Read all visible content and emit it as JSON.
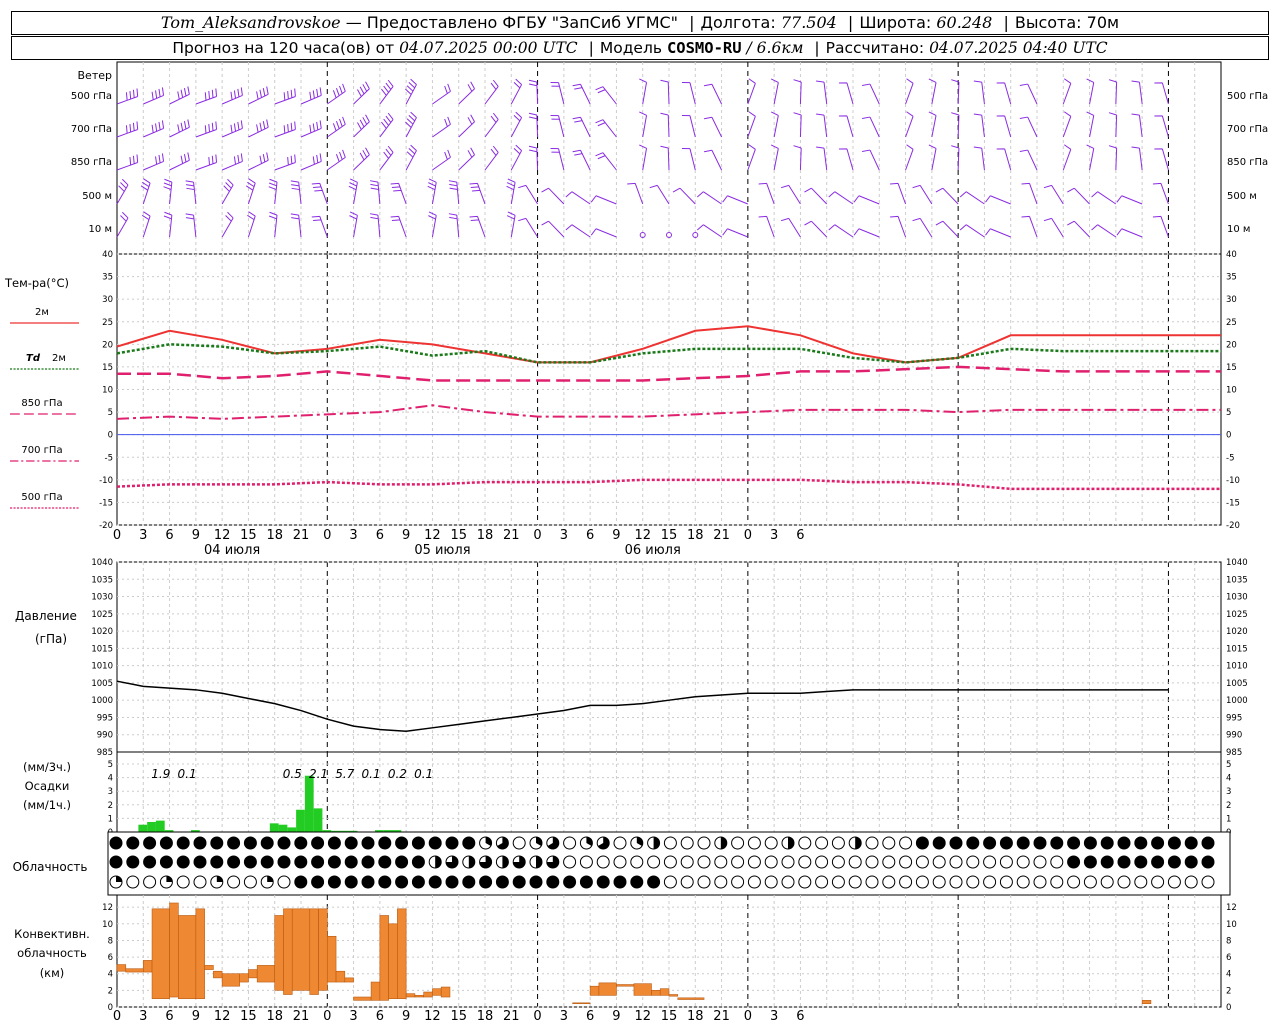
{
  "header": {
    "station": "Tom_Aleksandrovskoe",
    "provider": "— Предоставлено ФГБУ \"ЗапСиб УГМС\"",
    "lon_label": "Долгота:",
    "lon_value": "77.504",
    "lat_label": "Широта:",
    "lat_value": "60.248",
    "alt_label": "Высота:",
    "alt_value": "70м",
    "forecast_prefix": "Прогноз на 120 часа(ов) от",
    "forecast_start": "04.07.2025 00:00 UTC",
    "model_label": "Модель",
    "model_name": "COSMO-RU",
    "model_res": "/ 6.6км",
    "computed_label": "Рассчитано:",
    "computed_value": "04.07.2025 04:40 UTC"
  },
  "colors": {
    "wind": "#8a2be2",
    "t2m": "#ee3333",
    "td2m": "#1a7a1a",
    "t850": "#e0206e",
    "t700": "#e0206e",
    "t500": "#e0206e",
    "zero_line": "#4455ee",
    "precip": "#22cc22",
    "convective": "#ef8833",
    "grid": "#cccccc"
  },
  "x_axis": {
    "hour_ticks": [
      "0",
      "3",
      "6",
      "9",
      "12",
      "15",
      "18",
      "21",
      "0",
      "3",
      "6",
      "9",
      "12",
      "15",
      "18",
      "21",
      "0",
      "3",
      "6",
      "9",
      "12",
      "15",
      "18",
      "21",
      "0",
      "3",
      "6"
    ],
    "days": [
      "04 июля",
      "05 июля",
      "06 июля"
    ]
  },
  "wind_panel": {
    "title": "Ветер",
    "levels": [
      "500 гПа",
      "700 гПа",
      "850 гПа",
      "500 м",
      "10 м"
    ]
  },
  "temp_panel": {
    "legend": {
      "t2m": "2м",
      "td_sym": "Td",
      "td_lev": "2м",
      "t850": "850 гПа",
      "t700": "700 гПа",
      "t500": "500 гПа"
    }
  },
  "pressure_panel": {
    "title": "Давление",
    "unit": "(гПа)"
  },
  "precip_panel": {
    "unit3h": "(мм/3ч.)",
    "title": "Осадки",
    "unit1h": "(мм/1ч.)"
  },
  "cloud_panel": {
    "title": "Облачность"
  },
  "conv_panel": {
    "title": "Конвективн.",
    "title2": "облачность",
    "unit": "(км)"
  },
  "chart_data": [
    {
      "type": "line",
      "title": "Тем-ра(°С)",
      "x_hours": [
        0,
        6,
        12,
        18,
        24,
        30,
        36,
        42,
        48,
        54,
        60,
        66,
        72,
        78,
        84,
        90,
        96,
        102,
        108,
        114,
        120,
        126
      ],
      "ylim": [
        -20,
        40
      ],
      "yticks": [
        -20,
        -15,
        -10,
        -5,
        0,
        5,
        10,
        15,
        20,
        25,
        30,
        35,
        40
      ],
      "series": [
        {
          "name": "2м",
          "key": "t2m",
          "values": [
            19.5,
            23,
            21,
            18,
            19,
            21,
            20,
            18,
            16,
            16,
            19,
            23,
            24,
            22,
            18,
            16,
            17,
            22,
            22,
            22,
            22,
            22
          ]
        },
        {
          "name": "Td 2м",
          "key": "td2m",
          "values": [
            18,
            20,
            19.5,
            18,
            18.5,
            19.5,
            17.5,
            18.5,
            16,
            16,
            18,
            19,
            19,
            19,
            17,
            16,
            17,
            19,
            18.5,
            18.5,
            18.5,
            18.5
          ]
        },
        {
          "name": "850 гПа",
          "key": "t850",
          "values": [
            13.5,
            13.5,
            12.5,
            13,
            14,
            13,
            12,
            12,
            12,
            12,
            12,
            12.5,
            13,
            14,
            14,
            14.5,
            15,
            14.5,
            14,
            14,
            14,
            14
          ]
        },
        {
          "name": "700 гПа",
          "key": "t700",
          "values": [
            3.5,
            4,
            3.5,
            4,
            4.5,
            5,
            6.5,
            5,
            4,
            4,
            4,
            4.5,
            5,
            5.5,
            5.5,
            5.5,
            5,
            5.5,
            5.5,
            5.5,
            5.5,
            5.5
          ]
        },
        {
          "name": "500 гПа",
          "key": "t500",
          "values": [
            -11.5,
            -11,
            -11,
            -11,
            -10.5,
            -11,
            -11,
            -10.5,
            -10.5,
            -10.5,
            -10,
            -10,
            -10,
            -10,
            -10.5,
            -10.5,
            -11,
            -12,
            -12,
            -12,
            -12,
            -12
          ]
        }
      ]
    },
    {
      "type": "line",
      "title": "Давление",
      "x_hours": [
        0,
        3,
        6,
        9,
        12,
        15,
        18,
        21,
        24,
        27,
        30,
        33,
        36,
        39,
        42,
        45,
        48,
        51,
        54,
        57,
        60,
        63,
        66,
        69,
        72,
        75,
        78,
        81,
        84,
        87,
        90,
        93,
        96,
        99,
        102,
        105,
        108,
        111,
        114,
        117,
        120
      ],
      "values": [
        1005.5,
        1004,
        1003.5,
        1003,
        1002,
        1000.5,
        999,
        997,
        994.5,
        992.5,
        991.5,
        991,
        992,
        993,
        994,
        995,
        996,
        997,
        998.5,
        998.5,
        999,
        1000,
        1001,
        1001.5,
        1002,
        1002,
        1002,
        1002.5,
        1003,
        1003,
        1003,
        1003,
        1003,
        1003,
        1003,
        1003,
        1003,
        1003,
        1003,
        1003,
        1003
      ],
      "ylim": [
        985,
        1040
      ],
      "yticks": [
        985,
        990,
        995,
        1000,
        1005,
        1010,
        1015,
        1020,
        1025,
        1030,
        1035,
        1040
      ]
    },
    {
      "type": "bar",
      "title": "Осадки",
      "x_hours": [
        3,
        4,
        5,
        6,
        9,
        18,
        19,
        20,
        21,
        22,
        23,
        24,
        25,
        26,
        27,
        30,
        31,
        32
      ],
      "values": [
        0.5,
        0.7,
        0.8,
        0.1,
        0.1,
        0.6,
        0.5,
        0.3,
        1.6,
        4.1,
        1.7,
        0.1,
        0.05,
        0.05,
        0.05,
        0.1,
        0.1,
        0.1
      ],
      "ylim": [
        0,
        5
      ],
      "yticks": [
        0,
        1,
        2,
        3,
        4,
        5
      ],
      "totals_3h": [
        {
          "hour": 5,
          "label": "1.9"
        },
        {
          "hour": 8,
          "label": "0.1"
        },
        {
          "hour": 20,
          "label": "0.5"
        },
        {
          "hour": 23,
          "label": "2.1"
        },
        {
          "hour": 26,
          "label": "5.7"
        },
        {
          "hour": 29,
          "label": "0.1"
        },
        {
          "hour": 32,
          "label": "0.2"
        },
        {
          "hour": 35,
          "label": "0.1"
        }
      ]
    },
    {
      "type": "bar",
      "title": "Конвективн. облачность",
      "yticks": [
        0,
        2,
        4,
        6,
        8,
        10,
        12
      ],
      "ylim": [
        0,
        13
      ],
      "bars": [
        {
          "h0": 0,
          "h1": 1,
          "base": 4.3,
          "top": 5.1
        },
        {
          "h0": 1,
          "h1": 3,
          "base": 4.2,
          "top": 4.6
        },
        {
          "h0": 3,
          "h1": 4,
          "base": 4.2,
          "top": 5.6
        },
        {
          "h0": 4,
          "h1": 6,
          "base": 1.0,
          "top": 11.8
        },
        {
          "h0": 6,
          "h1": 7,
          "base": 1.2,
          "top": 12.5
        },
        {
          "h0": 7,
          "h1": 9,
          "base": 1.0,
          "top": 11.0
        },
        {
          "h0": 9,
          "h1": 10,
          "base": 1.0,
          "top": 11.8
        },
        {
          "h0": 10,
          "h1": 11,
          "base": 4.5,
          "top": 5.0
        },
        {
          "h0": 11,
          "h1": 12,
          "base": 3.5,
          "top": 4.3
        },
        {
          "h0": 12,
          "h1": 14,
          "base": 2.5,
          "top": 4.0
        },
        {
          "h0": 14,
          "h1": 15,
          "base": 3.0,
          "top": 4.0
        },
        {
          "h0": 15,
          "h1": 16,
          "base": 3.5,
          "top": 4.5
        },
        {
          "h0": 16,
          "h1": 18,
          "base": 3.0,
          "top": 5.0
        },
        {
          "h0": 18,
          "h1": 19,
          "base": 2.0,
          "top": 11.0
        },
        {
          "h0": 19,
          "h1": 20,
          "base": 1.5,
          "top": 11.8
        },
        {
          "h0": 20,
          "h1": 22,
          "base": 2.0,
          "top": 11.8
        },
        {
          "h0": 22,
          "h1": 23,
          "base": 1.5,
          "top": 11.8
        },
        {
          "h0": 23,
          "h1": 24,
          "base": 2.0,
          "top": 11.8
        },
        {
          "h0": 24,
          "h1": 25,
          "base": 3.0,
          "top": 8.5
        },
        {
          "h0": 25,
          "h1": 26,
          "base": 3.0,
          "top": 4.3
        },
        {
          "h0": 26,
          "h1": 27,
          "base": 3.0,
          "top": 3.5
        },
        {
          "h0": 27,
          "h1": 29,
          "base": 0.8,
          "top": 1.2
        },
        {
          "h0": 29,
          "h1": 30,
          "base": 0.8,
          "top": 3.0
        },
        {
          "h0": 30,
          "h1": 31,
          "base": 0.8,
          "top": 11.0
        },
        {
          "h0": 31,
          "h1": 32,
          "base": 1.0,
          "top": 10.0
        },
        {
          "h0": 32,
          "h1": 33,
          "base": 1.0,
          "top": 11.8
        },
        {
          "h0": 33,
          "h1": 34,
          "base": 1.2,
          "top": 1.6
        },
        {
          "h0": 34,
          "h1": 35,
          "base": 1.2,
          "top": 1.4
        },
        {
          "h0": 35,
          "h1": 36,
          "base": 1.2,
          "top": 1.8
        },
        {
          "h0": 36,
          "h1": 37,
          "base": 1.4,
          "top": 2.2
        },
        {
          "h0": 37,
          "h1": 38,
          "base": 1.2,
          "top": 2.4
        },
        {
          "h0": 52,
          "h1": 54,
          "base": 0.4,
          "top": 0.5
        },
        {
          "h0": 54,
          "h1": 55,
          "base": 1.4,
          "top": 2.5
        },
        {
          "h0": 55,
          "h1": 57,
          "base": 1.4,
          "top": 2.9
        },
        {
          "h0": 57,
          "h1": 59,
          "base": 2.5,
          "top": 2.7
        },
        {
          "h0": 59,
          "h1": 61,
          "base": 1.4,
          "top": 2.8
        },
        {
          "h0": 61,
          "h1": 62,
          "base": 1.4,
          "top": 2.0
        },
        {
          "h0": 62,
          "h1": 63,
          "base": 1.4,
          "top": 2.2
        },
        {
          "h0": 63,
          "h1": 64,
          "base": 1.3,
          "top": 1.5
        },
        {
          "h0": 64,
          "h1": 67,
          "base": 0.9,
          "top": 1.1
        },
        {
          "h0": 117,
          "h1": 118,
          "base": 0.4,
          "top": 0.8
        }
      ]
    }
  ]
}
